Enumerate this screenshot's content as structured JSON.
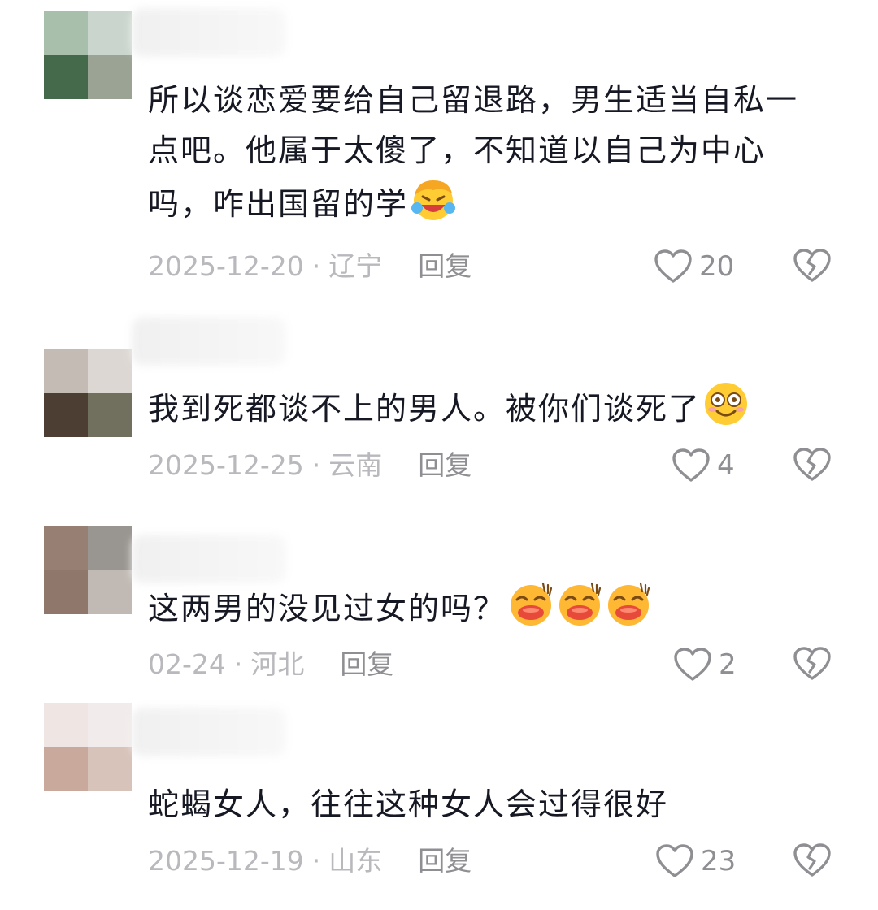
{
  "comments": [
    {
      "text": "所以谈恋爱要给自己留退路，男生适当自私一点吧。他属于太傻了，不知道以自己为中心吗，咋出国留的学",
      "emojis": [
        "laugh-cry-emoji"
      ],
      "date": "2025-12-20",
      "location": "辽宁",
      "reply_label": "回复",
      "likes": "20",
      "avatar_colors": [
        "#a8bfac",
        "#cad6cd",
        "#456a4b",
        "#9ba394"
      ]
    },
    {
      "text": "我到死都谈不上的男人。被你们谈死了",
      "emojis": [
        "dizzy-smile-emoji"
      ],
      "date": "2025-12-25",
      "location": "云南",
      "reply_label": "回复",
      "likes": "4",
      "avatar_colors": [
        "#c4bbb5",
        "#dcd7d2",
        "#4d3e33",
        "#71705f"
      ]
    },
    {
      "text": "这两男的没见过女的吗？",
      "emojis": [
        "drooling-emoji",
        "drooling-emoji",
        "drooling-emoji"
      ],
      "date": "02-24",
      "location": "河北",
      "reply_label": "回复",
      "likes": "2",
      "avatar_colors": [
        "#977f73",
        "#999590",
        "#8f786b",
        "#c1bab4"
      ]
    },
    {
      "text": "蛇蝎女人，往往这种女人会过得很好",
      "emojis": [],
      "date": "2025-12-19",
      "location": "山东",
      "reply_label": "回复",
      "likes": "23",
      "avatar_colors": [
        "#efe6e3",
        "#f1eceb",
        "#caa99d",
        "#d8c3bb"
      ]
    }
  ],
  "colors": {
    "text": "#161823",
    "meta": "#b8b8bd",
    "reply": "#8e8e93",
    "icon": "#8e8e93"
  },
  "icons": {
    "like": "heart-outline-icon",
    "dislike": "broken-heart-icon"
  }
}
